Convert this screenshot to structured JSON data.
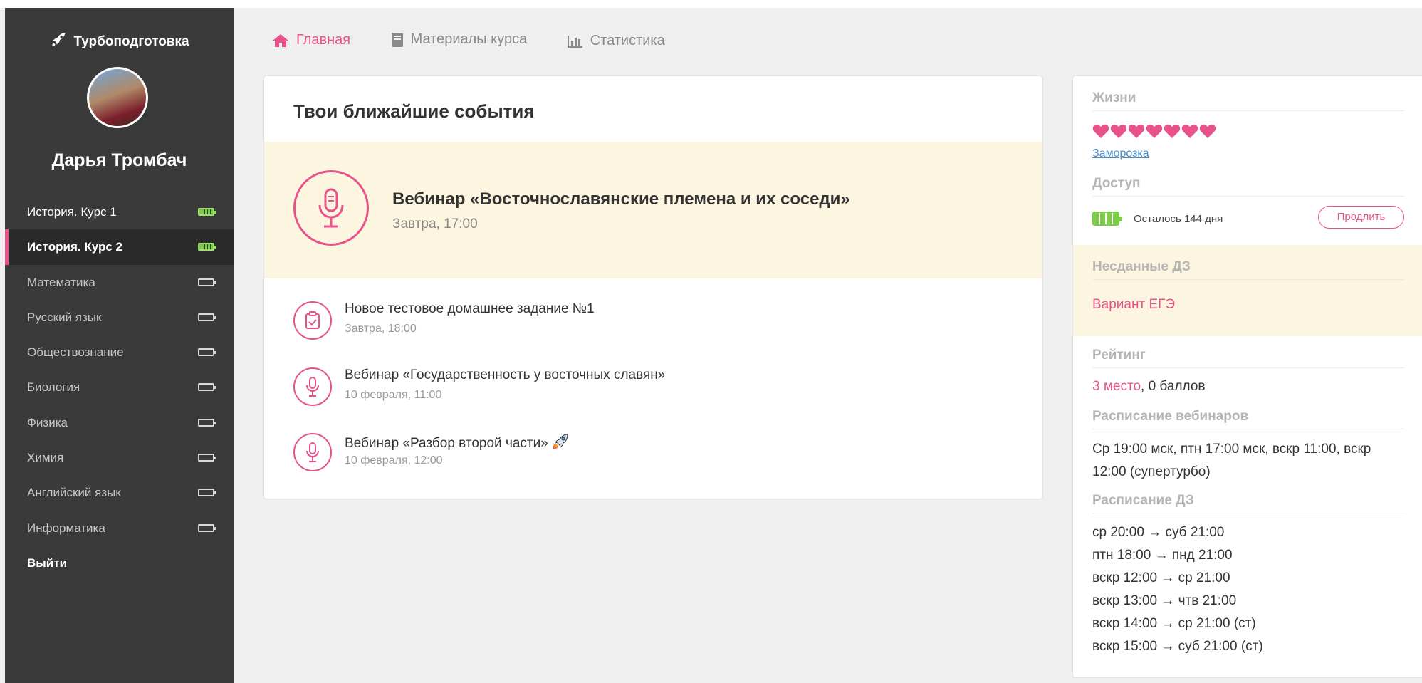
{
  "app": {
    "brand": "Турбоподготовка"
  },
  "user": {
    "name": "Дарья Тромбач"
  },
  "sidebar": {
    "items": [
      {
        "label": "История. Курс 1",
        "battery": "full"
      },
      {
        "label": "История. Курс 2",
        "battery": "full",
        "active": true
      },
      {
        "label": "Математика",
        "battery": "empty"
      },
      {
        "label": "Русский язык",
        "battery": "empty"
      },
      {
        "label": "Обществознание",
        "battery": "empty"
      },
      {
        "label": "Биология",
        "battery": "empty"
      },
      {
        "label": "Физика",
        "battery": "empty"
      },
      {
        "label": "Химия",
        "battery": "empty"
      },
      {
        "label": "Английский язык",
        "battery": "empty"
      },
      {
        "label": "Информатика",
        "battery": "empty"
      }
    ],
    "logout": "Выйти"
  },
  "topnav": {
    "home": "Главная",
    "materials": "Материалы курса",
    "stats": "Статистика"
  },
  "events": {
    "title": "Твои ближайшие события",
    "featured": {
      "title": "Вебинар «Восточнославянские племена и их соседи»",
      "time": "Завтра, 17:00",
      "icon": "microphone-icon"
    },
    "list": [
      {
        "title": "Новое тестовое домашнее задание №1",
        "time": "Завтра, 18:00",
        "icon": "clipboard-check-icon"
      },
      {
        "title": "Вебинар «Государственность у восточных славян»",
        "time": "10 февраля, 11:00",
        "icon": "microphone-icon"
      },
      {
        "title": "Вебинар «Разбор второй части»",
        "time": "10 февраля, 12:00",
        "icon": "microphone-icon"
      }
    ]
  },
  "side": {
    "lives": {
      "title": "Жизни",
      "count": 7,
      "freeze": "Заморозка"
    },
    "access": {
      "title": "Доступ",
      "remaining": "Осталось 144 дня",
      "extend": "Продлить"
    },
    "homework": {
      "title": "Несданные ДЗ",
      "item": "Вариант ЕГЭ"
    },
    "rating": {
      "title": "Рейтинг",
      "place": "3 место",
      "points": ", 0 баллов"
    },
    "webinar_schedule": {
      "title": "Расписание вебинаров",
      "text": "Ср 19:00 мск, птн 17:00 мск, вскр 11:00, вскр 12:00 (супертурбо)"
    },
    "hw_schedule": {
      "title": "Расписание ДЗ",
      "lines": [
        "ср 20:00 → суб 21:00",
        "птн 18:00 → пнд 21:00",
        "вскр 12:00 → ср 21:00",
        "вскр 13:00 → чтв 21:00",
        "вскр 14:00 → ср 21:00 (ст)",
        "вскр 15:00 → суб 21:00 (ст)"
      ]
    }
  },
  "colors": {
    "accent": "#e8528a",
    "sidebar": "#3a3a3a",
    "highlight": "#fcf6e1",
    "battery": "#7ccc4a"
  }
}
